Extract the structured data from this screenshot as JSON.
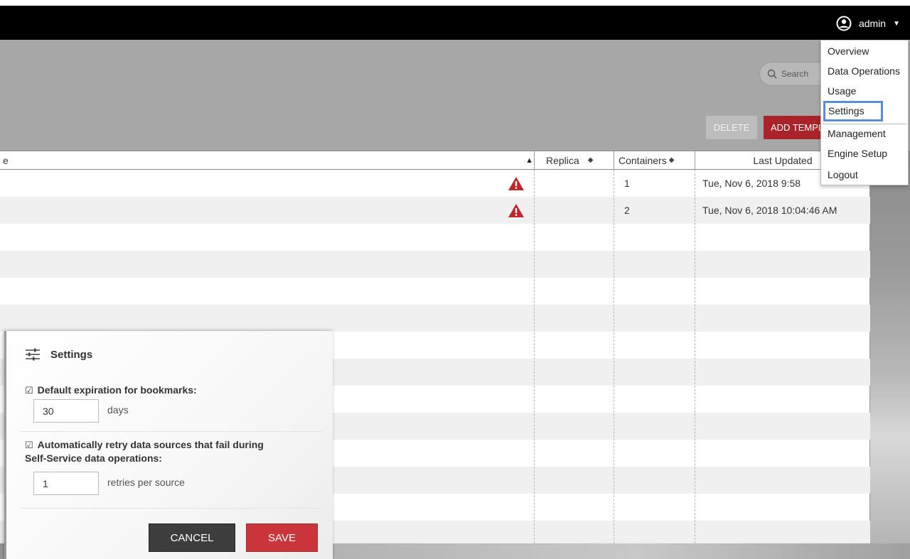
{
  "user": {
    "name": "admin"
  },
  "user_menu": {
    "items": [
      "Overview",
      "Data Operations",
      "Usage",
      "Settings",
      "Management",
      "Engine Setup",
      "Logout"
    ],
    "highlighted": "Settings"
  },
  "toolbar": {
    "search_placeholder": "Search",
    "delete_label": "DELETE",
    "add_template_label": "ADD TEMPLATE"
  },
  "table": {
    "columns": {
      "name": "e",
      "replica": "Replica",
      "containers": "Containers",
      "last_updated": "Last Updated"
    },
    "rows": [
      {
        "warning": true,
        "containers": "1",
        "last_updated": "Tue, Nov 6, 2018 9:58"
      },
      {
        "warning": true,
        "containers": "2",
        "last_updated": "Tue, Nov 6, 2018 10:04:46 AM"
      }
    ]
  },
  "settings_panel": {
    "title": "Settings",
    "bookmark_expiration": {
      "label": "Default expiration for bookmarks:",
      "value": "30",
      "unit": "days",
      "checked": true
    },
    "retry": {
      "label_line1": "Automatically retry data sources that fail during",
      "label_line2": "Self-Service data operations:",
      "value": "1",
      "unit": "retries per source",
      "checked": true
    },
    "cancel_label": "CANCEL",
    "save_label": "SAVE"
  },
  "colors": {
    "topbar": "#000000",
    "header": "#a7a7a7",
    "accent_red": "#c9353b",
    "highlight_blue": "#5b8dd6"
  },
  "icons": [
    "user-circle-icon",
    "chevron-down-icon",
    "search-icon",
    "warning-icon",
    "sliders-icon",
    "checkbox-icon"
  ]
}
